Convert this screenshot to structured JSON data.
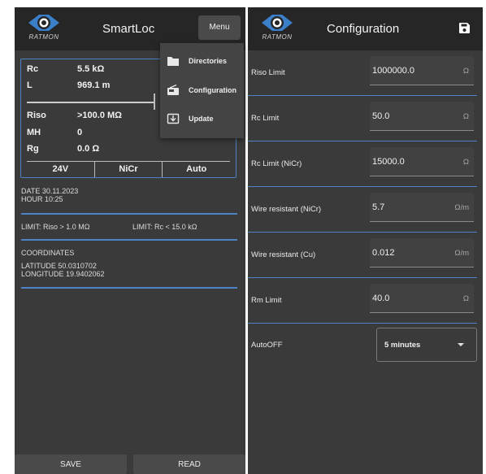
{
  "logo_text": "RATMON",
  "main": {
    "title": "SmartLoc",
    "menu_label": "Menu",
    "readings": [
      {
        "key": "Rc",
        "value": "5.5 kΩ"
      },
      {
        "key": "L",
        "value": "969.1 m"
      },
      {
        "key": "Riso",
        "value": ">100.0 MΩ"
      },
      {
        "key": "MH",
        "value": "0"
      },
      {
        "key": "Rg",
        "value": "0.0 Ω"
      }
    ],
    "status": [
      "24V",
      "NiCr",
      "Auto"
    ],
    "date_line": "DATE   30.11.2023",
    "hour_line": "HOUR   10:25",
    "limit_riso": "LIMIT: Riso > 1.0 MΩ",
    "limit_rc": "LIMIT: Rc < 15.0 kΩ",
    "coordinates_heading": "COORDINATES",
    "latitude_line": "LATITUDE    50.0310702",
    "longitude_line": "LONGITUDE   19.9402062",
    "save_label": "SAVE",
    "read_label": "READ",
    "dropdown": [
      {
        "label": "Directories",
        "icon": "folder-icon"
      },
      {
        "label": "Configuration",
        "icon": "radio-icon"
      },
      {
        "label": "Update",
        "icon": "download-box-icon"
      }
    ]
  },
  "config": {
    "title": "Configuration",
    "fields": [
      {
        "label": "Riso Limit",
        "value": "1000000.0",
        "unit": "Ω"
      },
      {
        "label": "Rc Limit",
        "value": "50.0",
        "unit": "Ω"
      },
      {
        "label": "Rc Limit (NiCr)",
        "value": "15000.0",
        "unit": "Ω"
      },
      {
        "label": "Wire resistant (NiCr)",
        "value": "5.7",
        "unit": "Ω/m"
      },
      {
        "label": "Wire resistant (Cu)",
        "value": "0.012",
        "unit": "Ω/m"
      },
      {
        "label": "Rm Limit",
        "value": "40.0",
        "unit": "Ω"
      }
    ],
    "autooff_label": "AutoOFF",
    "autooff_value": "5 minutes"
  },
  "colors": {
    "panel_bg": "#3a3a3a",
    "appbar_bg": "#262626",
    "accent_blue": "#4d82c4",
    "logo_blue": "#3a7fc8"
  }
}
